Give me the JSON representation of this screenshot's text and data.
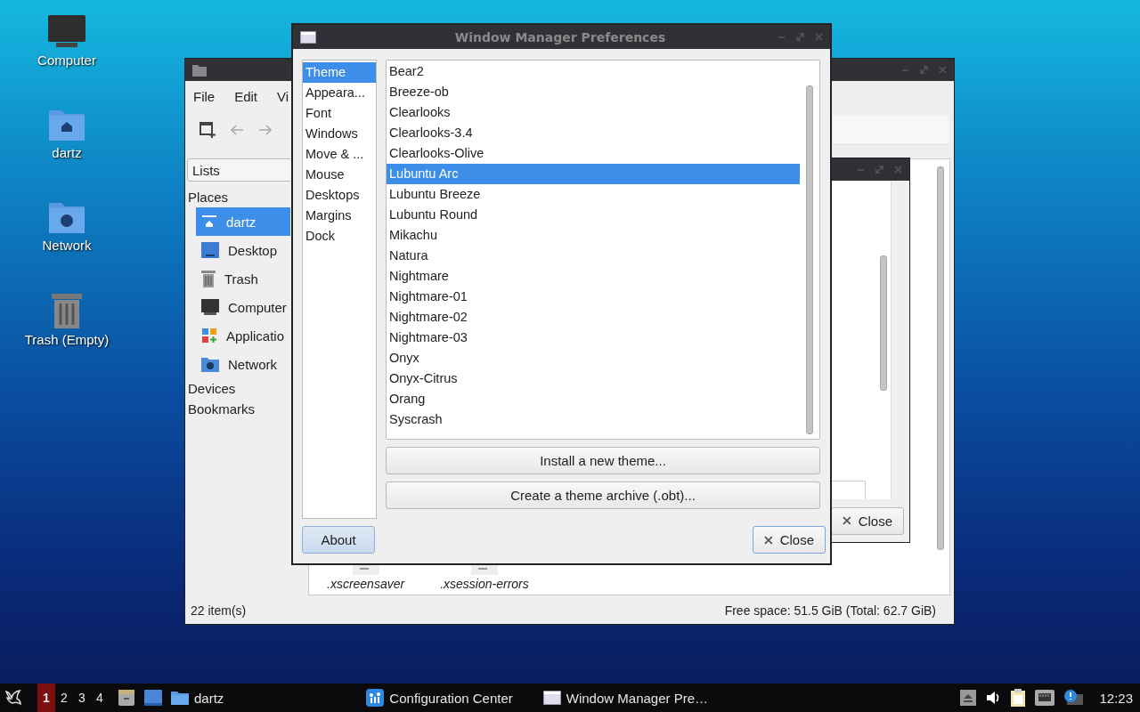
{
  "desktop_icons": [
    {
      "label": "Computer"
    },
    {
      "label": "dartz"
    },
    {
      "label": "Network"
    },
    {
      "label": "Trash (Empty)"
    }
  ],
  "file_manager": {
    "menu": [
      "File",
      "Edit",
      "Vi"
    ],
    "side_pane_mode": "Lists",
    "places_heading": "Places",
    "places": [
      {
        "label": "dartz",
        "selected": true
      },
      {
        "label": "Desktop",
        "selected": false
      },
      {
        "label": "Trash",
        "selected": false
      },
      {
        "label": "Computer",
        "selected": false
      },
      {
        "label": "Applicatio",
        "selected": false
      },
      {
        "label": "Network",
        "selected": false
      }
    ],
    "other_sections": [
      "Devices",
      "Bookmarks"
    ],
    "files": [
      ".xscreensaver",
      ".xsession-errors"
    ],
    "status_items": "22 item(s)",
    "status_space": "Free space: 51.5 GiB (Total: 62.7 GiB)"
  },
  "config_window": {
    "close_button": "Close"
  },
  "dialog": {
    "title": "Window Manager Preferences",
    "categories": [
      {
        "label": "Theme",
        "selected": true
      },
      {
        "label": "Appeara...",
        "selected": false
      },
      {
        "label": "Font",
        "selected": false
      },
      {
        "label": "Windows",
        "selected": false
      },
      {
        "label": "Move & ...",
        "selected": false
      },
      {
        "label": "Mouse",
        "selected": false
      },
      {
        "label": "Desktops",
        "selected": false
      },
      {
        "label": "Margins",
        "selected": false
      },
      {
        "label": "Dock",
        "selected": false
      }
    ],
    "themes": [
      {
        "label": "Bear2",
        "selected": false
      },
      {
        "label": "Breeze-ob",
        "selected": false
      },
      {
        "label": "Clearlooks",
        "selected": false
      },
      {
        "label": "Clearlooks-3.4",
        "selected": false
      },
      {
        "label": "Clearlooks-Olive",
        "selected": false
      },
      {
        "label": "Lubuntu Arc",
        "selected": true
      },
      {
        "label": "Lubuntu Breeze",
        "selected": false
      },
      {
        "label": "Lubuntu Round",
        "selected": false
      },
      {
        "label": "Mikachu",
        "selected": false
      },
      {
        "label": "Natura",
        "selected": false
      },
      {
        "label": "Nightmare",
        "selected": false
      },
      {
        "label": "Nightmare-01",
        "selected": false
      },
      {
        "label": "Nightmare-02",
        "selected": false
      },
      {
        "label": "Nightmare-03",
        "selected": false
      },
      {
        "label": "Onyx",
        "selected": false
      },
      {
        "label": "Onyx-Citrus",
        "selected": false
      },
      {
        "label": "Orang",
        "selected": false
      },
      {
        "label": "Syscrash",
        "selected": false
      }
    ],
    "buttons": [
      "Install a new theme...",
      "Create a theme archive (.obt)..."
    ],
    "about_button": "About",
    "close_button": "Close"
  },
  "taskbar": {
    "workspaces": [
      {
        "label": "1",
        "selected": true
      },
      {
        "label": "2",
        "selected": false
      },
      {
        "label": "3",
        "selected": false
      },
      {
        "label": "4",
        "selected": false
      }
    ],
    "tasks": [
      {
        "label": "dartz"
      },
      {
        "label": "Configuration Center"
      },
      {
        "label": "Window Manager Pre…"
      }
    ],
    "clock": "12:23"
  }
}
